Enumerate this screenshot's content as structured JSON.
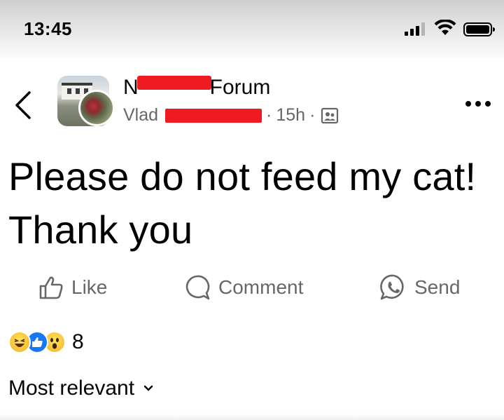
{
  "status_bar": {
    "time": "13:45",
    "signal_icon": "cellular-signal-icon",
    "wifi_icon": "wifi-icon",
    "battery_icon": "battery-icon"
  },
  "header": {
    "back_icon": "chevron-left-icon",
    "group_name_prefix": "N",
    "group_name_suffix": "Forum",
    "author_first_name": "Vlad",
    "timestamp": "15h",
    "separator": "·",
    "audience_icon": "group-members-icon",
    "more_icon": "more-horizontal-icon"
  },
  "post": {
    "text": "Please do not feed my cat! Thank you"
  },
  "actions": {
    "like_label": "Like",
    "comment_label": "Comment",
    "send_label": "Send"
  },
  "reactions": {
    "icons": [
      "haha-reaction-icon",
      "like-reaction-icon",
      "wow-reaction-icon"
    ],
    "count": "8"
  },
  "comments": {
    "sort_label": "Most relevant"
  },
  "colors": {
    "text_primary": "#050505",
    "text_secondary": "#65676b",
    "facebook_blue": "#1877f2",
    "redaction_red": "#ee1c22"
  }
}
